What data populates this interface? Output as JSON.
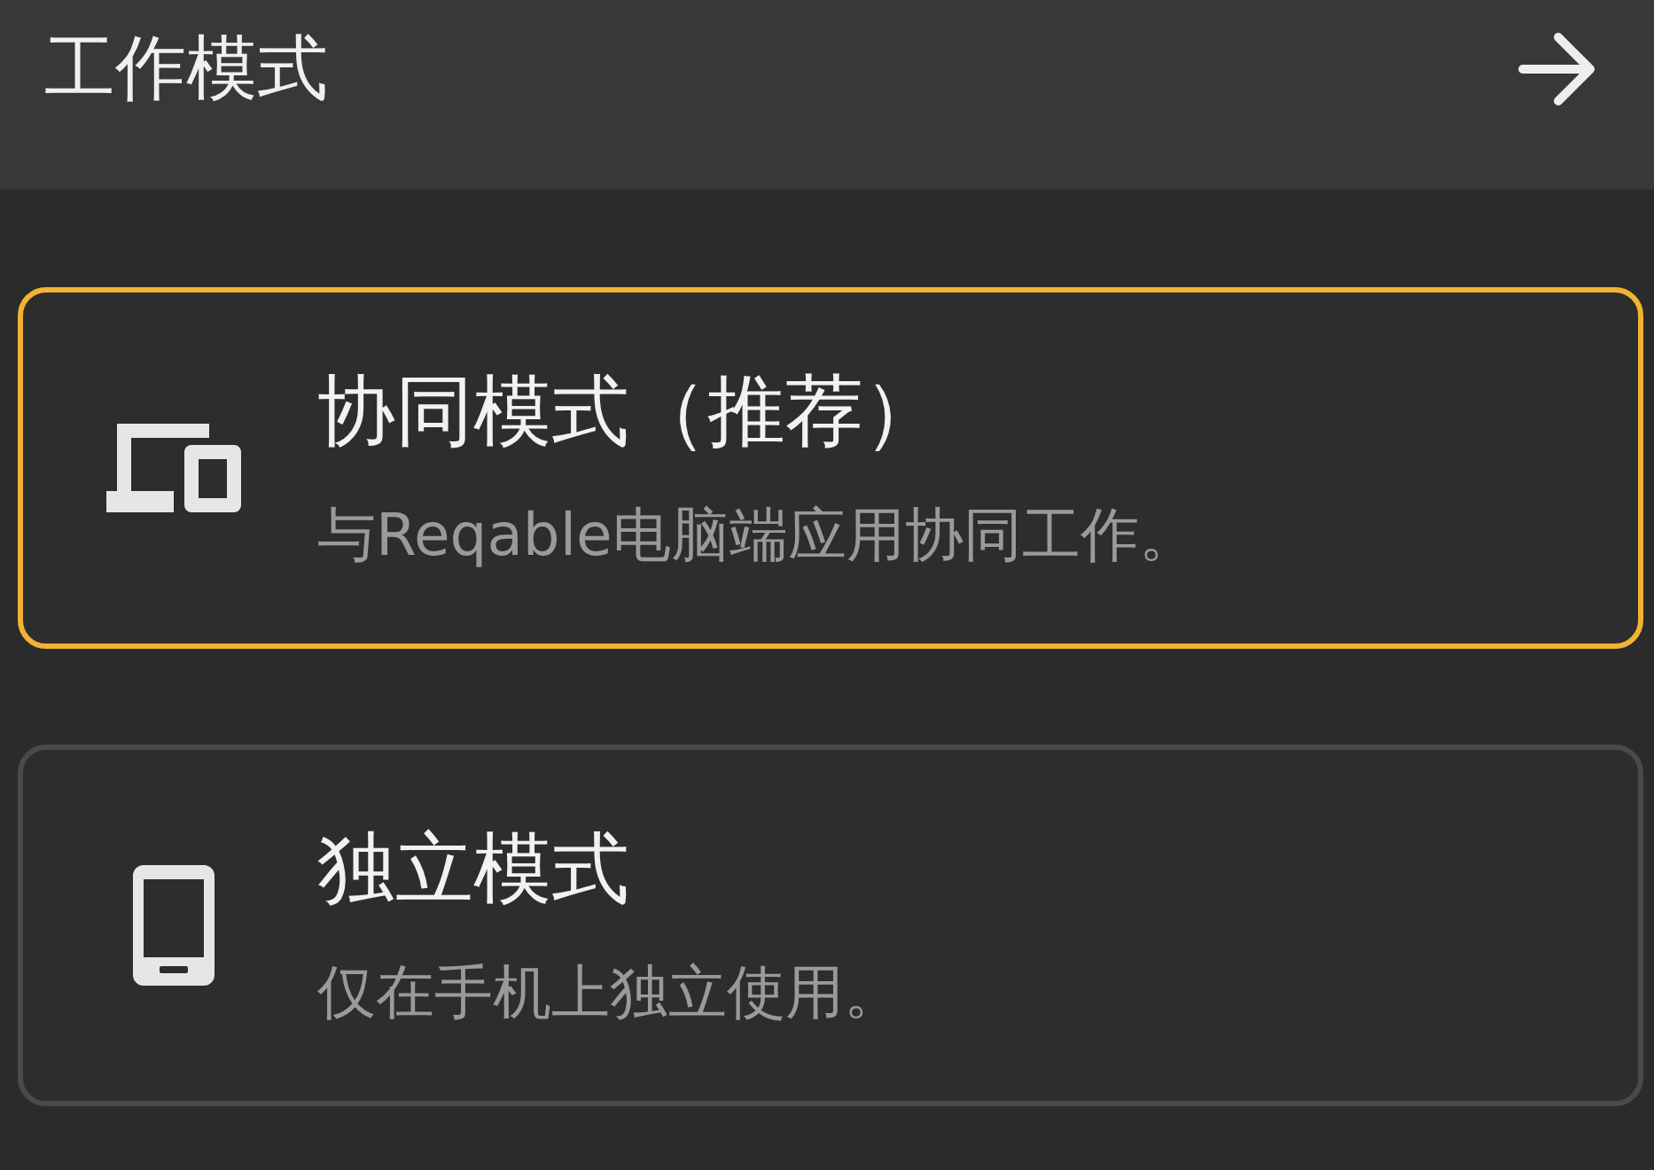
{
  "app_bar": {
    "title": "工作模式"
  },
  "modes": [
    {
      "kind": "devices",
      "title": "协同模式（推荐）",
      "description": "与Reqable电脑端应用协同工作。",
      "selected": true
    },
    {
      "kind": "phone",
      "title": "独立模式",
      "description": "仅在手机上独立使用。",
      "selected": false
    }
  ]
}
